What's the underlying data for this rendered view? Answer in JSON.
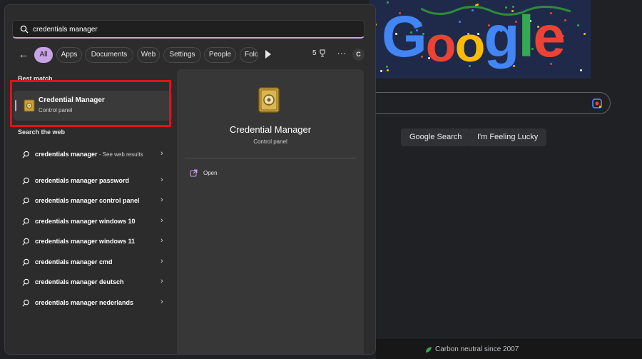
{
  "search": {
    "query": "credentials manager"
  },
  "filters": {
    "back": "←",
    "items": [
      "All",
      "Apps",
      "Documents",
      "Web",
      "Settings",
      "People",
      "Folders"
    ],
    "points": "5",
    "more": "···",
    "avatar_initial": "C"
  },
  "best_match": {
    "heading": "Best match",
    "title": "Credential Manager",
    "subtitle": "Control panel"
  },
  "web": {
    "heading": "Search the web",
    "items": [
      {
        "label": "credentials manager",
        "suffix": " - See web results"
      },
      {
        "label": "credentials manager password"
      },
      {
        "label": "credentials manager control panel"
      },
      {
        "label": "credentials manager windows 10"
      },
      {
        "label": "credentials manager windows 11"
      },
      {
        "label": "credentials manager cmd"
      },
      {
        "label": "credentials manager deutsch"
      },
      {
        "label": "credentials manager nederlands"
      }
    ]
  },
  "preview": {
    "title": "Credential Manager",
    "subtitle": "Control panel",
    "action_open": "Open"
  },
  "google": {
    "logo_letters": [
      "G",
      "o",
      "o",
      "g",
      "l",
      "e"
    ],
    "search_button": "Google Search",
    "lucky_button": "I'm Feeling Lucky",
    "footer": "Carbon neutral since 2007"
  },
  "colors": {
    "accent": "#c8a3e6",
    "highlight_box": "#e3101a",
    "panel_bg": "#2c2c2c",
    "preview_bg": "#373737"
  },
  "icons": {
    "search": "search-icon",
    "best_match": "credential-manager-vault-icon",
    "web_result": "search-icon",
    "open": "open-external-icon",
    "footer": "leaf-icon",
    "lens": "google-lens-icon"
  }
}
